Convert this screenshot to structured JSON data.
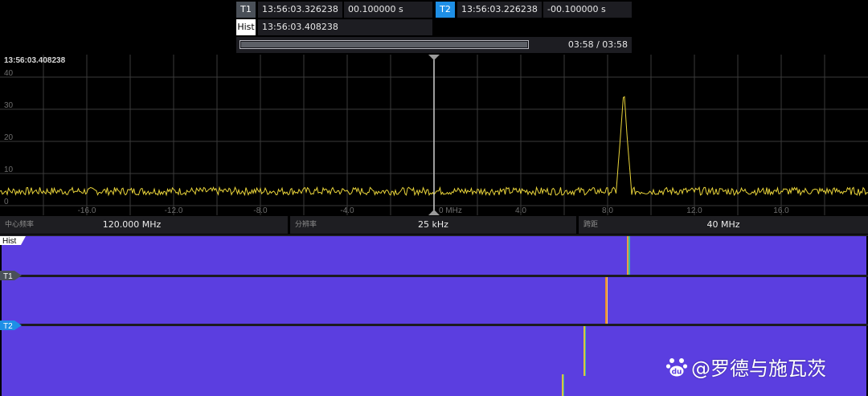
{
  "cursors": {
    "t1": {
      "label": "T1",
      "time": "13:56:03.326238",
      "offset": "00.100000 s"
    },
    "t2": {
      "label": "T2",
      "time": "13:56:03.226238",
      "offset": "-00.100000 s"
    },
    "hist": {
      "label": "Hist",
      "time": "13:56:03.408238"
    }
  },
  "playback": {
    "progress": 1.0,
    "time": "03:58 / 03:58"
  },
  "spectrum": {
    "timestamp": "13:56:03.408238",
    "y_ticks": [
      "0",
      "10",
      "20",
      "30",
      "40"
    ],
    "x_ticks": [
      "-16.0",
      "-12.0",
      "-8.0",
      "-4.0",
      "0 MHz",
      "4.0",
      "8.0",
      "12.0",
      "16.0"
    ]
  },
  "params": {
    "center_freq": {
      "label": "中心频率",
      "value": "120.000 MHz"
    },
    "resolution": {
      "label": "分辨率",
      "value": "25 kHz"
    },
    "span": {
      "label": "跨距",
      "value": "40 MHz"
    }
  },
  "waterfalls": {
    "hist": {
      "label": "Hist"
    },
    "t1": {
      "label": "T1"
    },
    "t2": {
      "label": "T2"
    }
  },
  "chart_data": {
    "type": "line",
    "title": "",
    "xlabel": "",
    "ylabel": "",
    "xlim": [
      -20,
      20
    ],
    "ylim": [
      -3,
      47
    ],
    "x_unit": "MHz",
    "baseline_level": 4.5,
    "series": [
      {
        "x": [
          -20,
          8.4,
          8.6,
          8.75,
          8.9,
          9.1,
          20
        ],
        "y": [
          4.5,
          5,
          22,
          36.5,
          21,
          5,
          4.5
        ]
      }
    ],
    "grid": true
  },
  "watermark": {
    "text": "@罗德与施瓦茨"
  },
  "colors": {
    "trace": "#e8d33a",
    "waterfall_bg": "#5b3ee0",
    "t2_accent": "#1e8fe6",
    "hist_tag": "#ffffff",
    "t1_tag": "#4a5058"
  }
}
